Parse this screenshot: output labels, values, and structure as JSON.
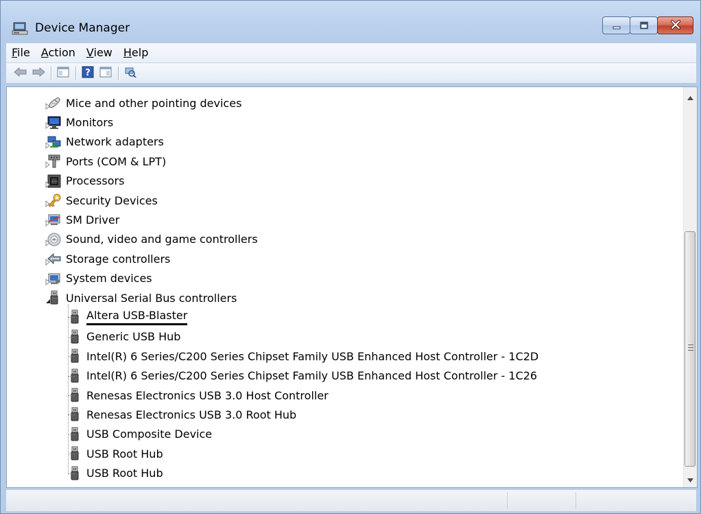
{
  "window": {
    "title": "Device Manager",
    "title_icon": "device-manager-icon"
  },
  "caption_buttons": {
    "minimize": "minimize-icon",
    "maximize": "maximize-icon",
    "close": "close-icon"
  },
  "menu": {
    "items": [
      {
        "access_key": "F",
        "rest": "ile"
      },
      {
        "access_key": "A",
        "rest": "ction"
      },
      {
        "access_key": "V",
        "rest": "iew"
      },
      {
        "access_key": "H",
        "rest": "elp"
      }
    ]
  },
  "toolbar": {
    "buttons": [
      "back-arrow-icon",
      "forward-arrow-icon",
      "show-hide-console-tree-icon",
      "help-icon",
      "show-hide-action-pane-icon",
      "scan-hardware-changes-icon"
    ]
  },
  "tree": {
    "categories": [
      {
        "label": "Mice and other pointing devices",
        "icon": "mouse-icon",
        "expanded": false
      },
      {
        "label": "Monitors",
        "icon": "monitor-icon",
        "expanded": false
      },
      {
        "label": "Network adapters",
        "icon": "network-adapter-icon",
        "expanded": false
      },
      {
        "label": "Ports (COM & LPT)",
        "icon": "port-icon",
        "expanded": false
      },
      {
        "label": "Processors",
        "icon": "processor-icon",
        "expanded": false
      },
      {
        "label": "Security Devices",
        "icon": "security-key-icon",
        "expanded": false
      },
      {
        "label": "SM Driver",
        "icon": "sm-driver-icon",
        "expanded": false
      },
      {
        "label": "Sound, video and game controllers",
        "icon": "sound-icon",
        "expanded": false
      },
      {
        "label": "Storage controllers",
        "icon": "storage-icon",
        "expanded": false
      },
      {
        "label": "System devices",
        "icon": "system-device-icon",
        "expanded": false
      },
      {
        "label": "Universal Serial Bus controllers",
        "icon": "usb-icon",
        "expanded": true
      }
    ],
    "usb_children": [
      {
        "label": "Altera USB-Blaster",
        "icon": "usb-device-icon",
        "underlined": true
      },
      {
        "label": "Generic USB Hub",
        "icon": "usb-device-icon"
      },
      {
        "label": "Intel(R) 6 Series/C200 Series Chipset Family USB Enhanced Host Controller - 1C2D",
        "icon": "usb-device-icon"
      },
      {
        "label": "Intel(R) 6 Series/C200 Series Chipset Family USB Enhanced Host Controller - 1C26",
        "icon": "usb-device-icon"
      },
      {
        "label": "Renesas Electronics USB 3.0 Host Controller",
        "icon": "usb-device-icon"
      },
      {
        "label": "Renesas Electronics USB 3.0 Root Hub",
        "icon": "usb-device-icon"
      },
      {
        "label": "USB Composite Device",
        "icon": "usb-device-icon"
      },
      {
        "label": "USB Root Hub",
        "icon": "usb-device-icon"
      },
      {
        "label": "USB Root Hub",
        "icon": "usb-device-icon"
      }
    ]
  },
  "colors": {
    "frame": "#b9cfeb",
    "close_button": "#c7482f",
    "tree_background": "#ffffff"
  }
}
